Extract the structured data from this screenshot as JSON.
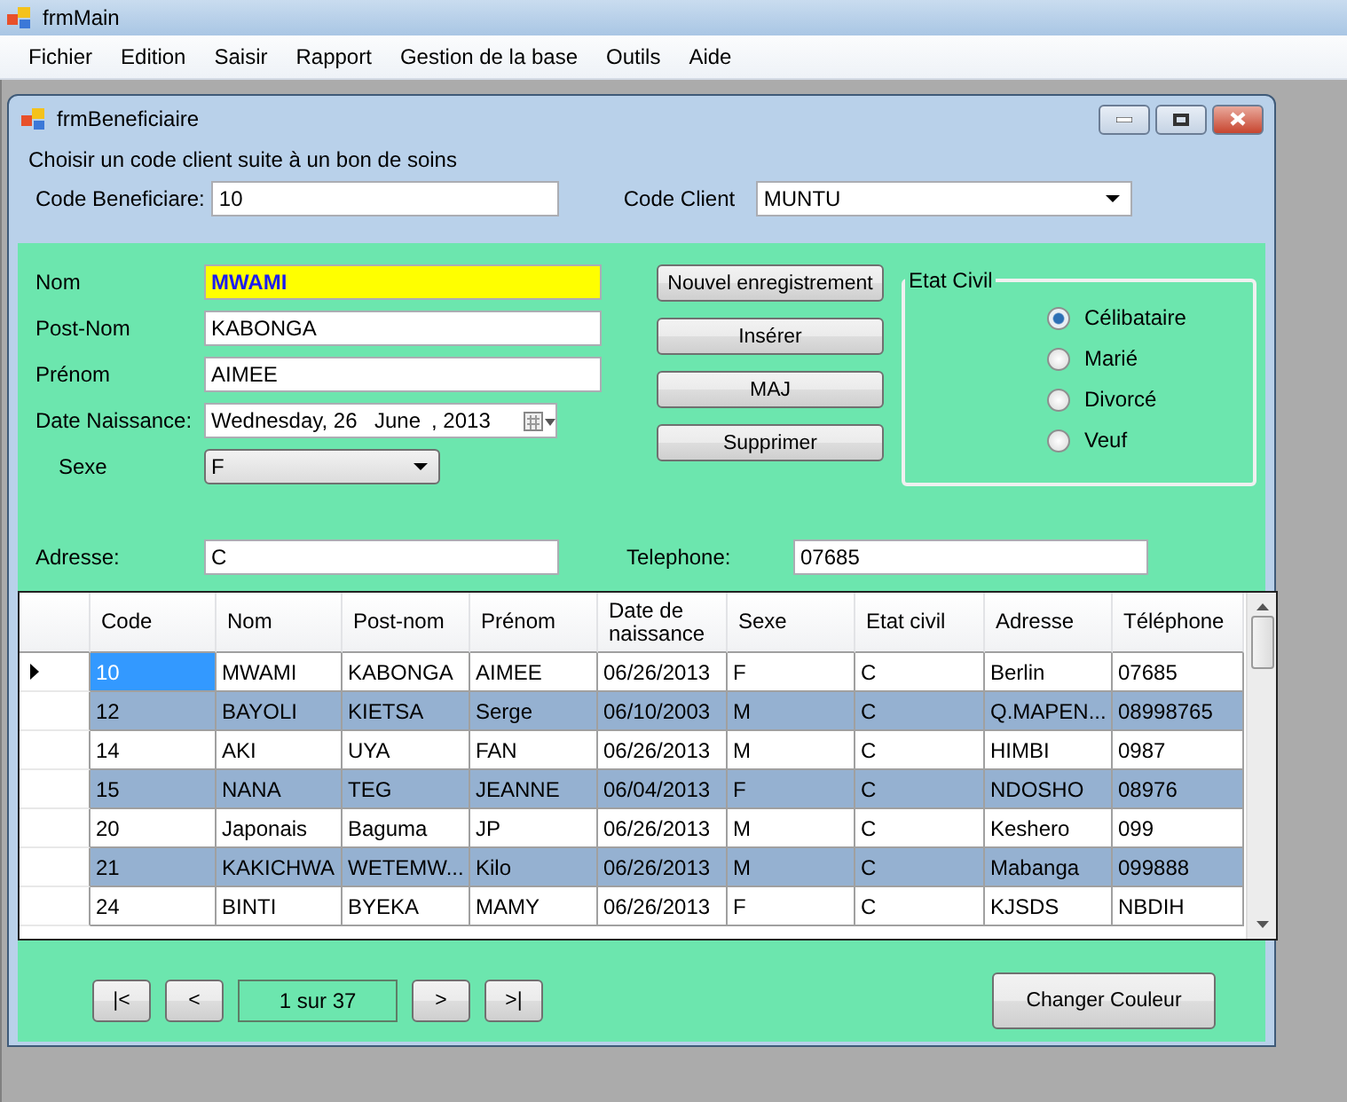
{
  "main_window": {
    "title": "frmMain",
    "menu": [
      "Fichier",
      "Edition",
      "Saisir",
      "Rapport",
      "Gestion de la base",
      "Outils",
      "Aide"
    ]
  },
  "child_window": {
    "title": "frmBeneficiaire"
  },
  "header": {
    "hint": "Choisir un code client suite à un bon de soins",
    "code_beneficiaire": {
      "label": "Code Beneficiare:",
      "value": "10"
    },
    "code_client": {
      "label": "Code Client",
      "value": "MUNTU"
    }
  },
  "form": {
    "fields": [
      {
        "kind": "text",
        "label": "Nom",
        "value": "MWAMI",
        "focused": true
      },
      {
        "kind": "text",
        "label": "Post-Nom",
        "value": "KABONGA",
        "focused": false
      },
      {
        "kind": "text",
        "label": "Prénom",
        "value": "AIMEE",
        "focused": false
      },
      {
        "kind": "date",
        "label": "Date Naissance:",
        "weekday": "Wednesday, 26",
        "month": "June",
        "year": ", 2013",
        "focused": false
      },
      {
        "kind": "select",
        "label": "Sexe",
        "value": "F",
        "focused": false
      }
    ],
    "adresse": {
      "label": "Adresse:",
      "value": "C"
    },
    "telephone": {
      "label": "Telephone:",
      "value": "07685"
    },
    "buttons": [
      "Nouvel enregistrement",
      "Insérer",
      "MAJ",
      "Supprimer"
    ],
    "etat_civil": {
      "title": "Etat Civil",
      "options": [
        {
          "label": "Célibataire",
          "selected": true
        },
        {
          "label": "Marié",
          "selected": false
        },
        {
          "label": "Divorcé",
          "selected": false
        },
        {
          "label": "Veuf",
          "selected": false
        }
      ]
    }
  },
  "table": {
    "columns": [
      "Code",
      "Nom",
      "Post-nom",
      "Prénom",
      "Date de naissance",
      "Sexe",
      "Etat civil",
      "Adresse",
      "Téléphone"
    ],
    "rows": [
      {
        "current": true,
        "cells": [
          "10",
          "MWAMI",
          "KABONGA",
          "AIMEE",
          "06/26/2013",
          "F",
          "C",
          "Berlin",
          "07685"
        ]
      },
      {
        "current": false,
        "cells": [
          "12",
          "BAYOLI",
          "KIETSA",
          "Serge",
          "06/10/2003",
          "M",
          "C",
          "Q.MAPEN...",
          "08998765"
        ]
      },
      {
        "current": false,
        "cells": [
          "14",
          "AKI",
          "UYA",
          "FAN",
          "06/26/2013",
          "M",
          "C",
          "HIMBI",
          "0987"
        ]
      },
      {
        "current": false,
        "cells": [
          "15",
          "NANA",
          "TEG",
          "JEANNE",
          "06/04/2013",
          "F",
          "C",
          "NDOSHO",
          "08976"
        ]
      },
      {
        "current": false,
        "cells": [
          "20",
          "Japonais",
          "Baguma",
          "JP",
          "06/26/2013",
          "M",
          "C",
          "Keshero",
          "099"
        ]
      },
      {
        "current": false,
        "cells": [
          "21",
          "KAKICHWA",
          "WETEMW...",
          "Kilo",
          "06/26/2013",
          "M",
          "C",
          "Mabanga",
          "099888"
        ]
      },
      {
        "current": false,
        "cells": [
          "24",
          "BINTI",
          "BYEKA",
          "MAMY",
          "06/26/2013",
          "F",
          "C",
          "KJSDS",
          "NBDIH"
        ]
      }
    ]
  },
  "pager": {
    "first": "|<",
    "previous": "<",
    "position": "1 sur 37",
    "next": ">",
    "last": ">|"
  },
  "color_button": "Changer Couleur"
}
